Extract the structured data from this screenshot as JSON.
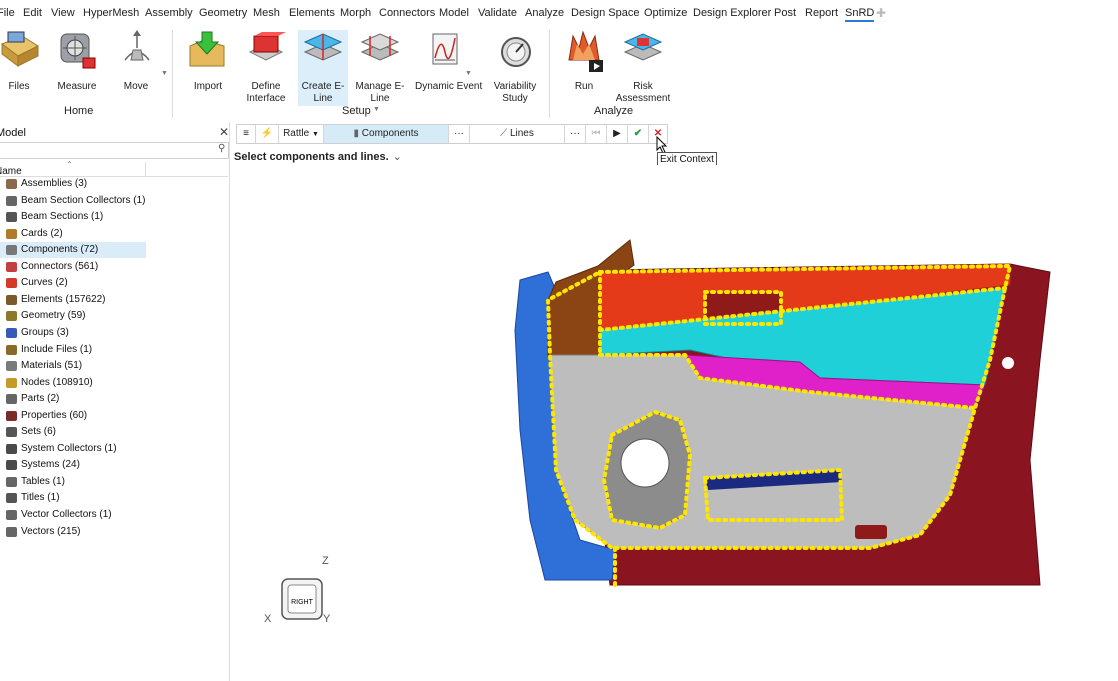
{
  "menu": {
    "items": [
      "File",
      "Edit",
      "View",
      "HyperMesh",
      "Assembly",
      "Geometry",
      "Mesh",
      "Elements",
      "Morph",
      "Connectors",
      "Model",
      "Validate",
      "Analyze",
      "Design Space",
      "Optimize",
      "Design Explorer",
      "Post",
      "Report",
      "SnRD"
    ],
    "active": "SnRD"
  },
  "ribbon": {
    "tools": [
      "Files",
      "Measure",
      "Move",
      "Import",
      "Define Interface",
      "Create E-Line",
      "Manage E-Line",
      "Dynamic Event",
      "Variability Study",
      "Run",
      "Risk Assessment"
    ],
    "groups": {
      "home": "Home",
      "setup": "Setup",
      "analyze": "Analyze"
    }
  },
  "browser": {
    "title": "Model",
    "column": "Name",
    "items": [
      {
        "label": "Assemblies  (3)",
        "icon": "assemblies-icon"
      },
      {
        "label": "Beam Section Collectors  (1)",
        "icon": "beam-section-collectors-icon"
      },
      {
        "label": "Beam Sections  (1)",
        "icon": "beam-sections-icon"
      },
      {
        "label": "Cards  (2)",
        "icon": "cards-icon"
      },
      {
        "label": "Components  (72)",
        "icon": "components-icon"
      },
      {
        "label": "Connectors  (561)",
        "icon": "connectors-icon"
      },
      {
        "label": "Curves  (2)",
        "icon": "curves-icon"
      },
      {
        "label": "Elements  (157622)",
        "icon": "elements-icon"
      },
      {
        "label": "Geometry  (59)",
        "icon": "geometry-icon"
      },
      {
        "label": "Groups  (3)",
        "icon": "groups-icon"
      },
      {
        "label": "Include Files  (1)",
        "icon": "include-files-icon"
      },
      {
        "label": "Materials  (51)",
        "icon": "materials-icon"
      },
      {
        "label": "Nodes  (108910)",
        "icon": "nodes-icon"
      },
      {
        "label": "Parts  (2)",
        "icon": "parts-icon"
      },
      {
        "label": "Properties  (60)",
        "icon": "properties-icon"
      },
      {
        "label": "Sets  (6)",
        "icon": "sets-icon"
      },
      {
        "label": "System Collectors  (1)",
        "icon": "system-collectors-icon"
      },
      {
        "label": "Systems  (24)",
        "icon": "systems-icon"
      },
      {
        "label": "Tables  (1)",
        "icon": "tables-icon"
      },
      {
        "label": "Titles  (1)",
        "icon": "titles-icon"
      },
      {
        "label": "Vector Collectors  (1)",
        "icon": "vector-collectors-icon"
      },
      {
        "label": "Vectors  (215)",
        "icon": "vectors-icon"
      }
    ],
    "selected": "Components  (72)"
  },
  "context": {
    "menu_icon": "≡",
    "rattle": "Rattle",
    "components": "Components",
    "more1": "···",
    "lines": "Lines",
    "more2": "···",
    "prompt": "Select components and lines.",
    "tooltip": "Exit Context"
  },
  "triad": {
    "view": "RIGHT",
    "z": "Z",
    "x": "X",
    "y": "Y"
  },
  "colors": {
    "accent": "#2b7bd6",
    "selection": "#d9ecf8",
    "highlight": "#ffe600"
  }
}
